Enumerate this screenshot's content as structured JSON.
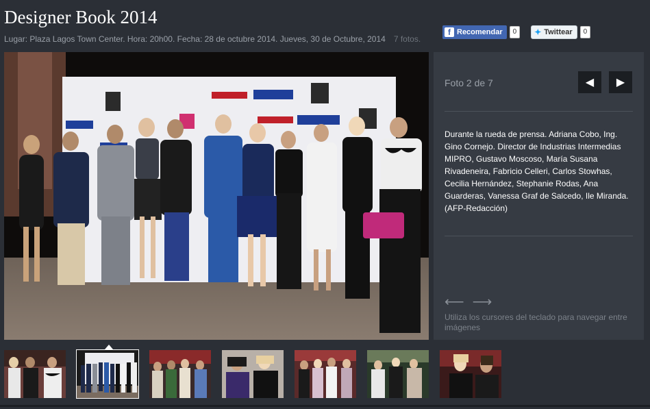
{
  "header": {
    "title": "Designer Book 2014",
    "meta": "Lugar: Plaza Lagos Town Center. Hora: 20h00. Fecha: 28 de octubre 2014. Jueves, 30 de Octubre, 2014",
    "photo_count": "7 fotos."
  },
  "social": {
    "facebook_label": "Recomendar",
    "facebook_count": "0",
    "twitter_label": "Twittear",
    "twitter_count": "0"
  },
  "viewer": {
    "photo_position": "Foto 2 de 7",
    "prev_icon": "chevron-left-icon",
    "next_icon": "chevron-right-icon",
    "caption": "Durante la rueda de prensa. Adriana Cobo, Ing. Gino Cornejo. Director de Industrias Intermedias MIPRO, Gustavo Moscoso, María Susana Rivadeneira, Fabricio Celleri, Carlos Stowhas, Cecilia Hernández, Stephanie Rodas, Ana Guarderas, Vanessa Graf de Salcedo, Ile Miranda. (AFP-Redacción)",
    "keyboard_hint": "Utiliza los cursores del teclado para navegar entre imágenes"
  },
  "thumbnails": {
    "active_index": 1,
    "items": [
      "thumb-1",
      "thumb-2",
      "thumb-3",
      "thumb-4",
      "thumb-5",
      "thumb-6",
      "thumb-7"
    ]
  },
  "colors": {
    "background": "#2b2f36",
    "panel": "#363b43",
    "facebook": "#4267b2",
    "twitter": "#1da1f2"
  }
}
